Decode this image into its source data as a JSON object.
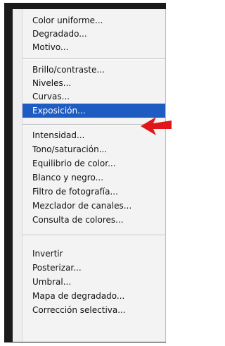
{
  "menu": {
    "groups": [
      {
        "items": [
          "Color uniforme...",
          "Degradado...",
          "Motivo..."
        ]
      },
      {
        "items": [
          "Brillo/contraste...",
          "Niveles...",
          "Curvas...",
          "Exposición..."
        ]
      },
      {
        "items": [
          "Intensidad...",
          "Tono/saturación...",
          "Equilibrio de color...",
          "Blanco y negro...",
          "Filtro de fotografía...",
          "Mezclador de canales...",
          "Consulta de colores..."
        ]
      },
      {
        "items": [
          "Invertir",
          "Posterizar...",
          "Umbral...",
          "Mapa de degradado...",
          "Corrección selectiva..."
        ]
      }
    ],
    "selected_item": "Exposición..."
  },
  "colors": {
    "highlight": "#1f5cc2",
    "arrow": "#e0161b"
  },
  "icons": {
    "pointer": "red-arrow-icon"
  }
}
